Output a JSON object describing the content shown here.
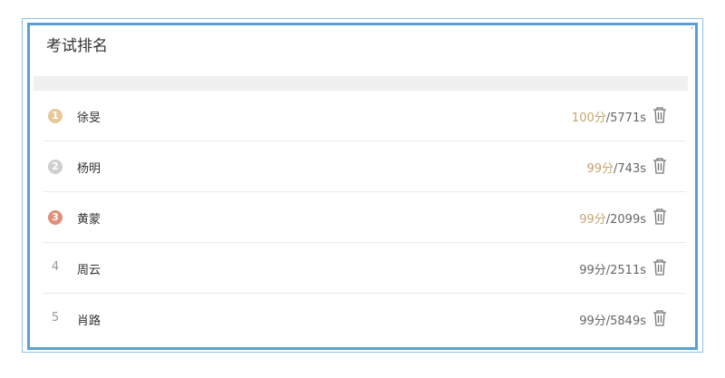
{
  "panel": {
    "title": "考试排名"
  },
  "ranking": [
    {
      "rank": "1",
      "name": "徐旻",
      "score": "100分",
      "time": "/5771s",
      "badge_color": "#e6c99a",
      "highlight": true
    },
    {
      "rank": "2",
      "name": "杨明",
      "score": "99分",
      "time": "/743s",
      "badge_color": "#cfcfcf",
      "highlight": true
    },
    {
      "rank": "3",
      "name": "黄蒙",
      "score": "99分",
      "time": "/2099s",
      "badge_color": "#e0907a",
      "highlight": true
    },
    {
      "rank": "4",
      "name": "周云",
      "score": "99分",
      "time": "/2511s",
      "badge_color": "",
      "highlight": false
    },
    {
      "rank": "5",
      "name": "肖路",
      "score": "99分",
      "time": "/5849s",
      "badge_color": "",
      "highlight": false
    }
  ],
  "icons": {
    "delete": "trash-icon"
  },
  "colors": {
    "frame_border": "#5b9fd9",
    "score_highlight": "#c8a46e"
  }
}
